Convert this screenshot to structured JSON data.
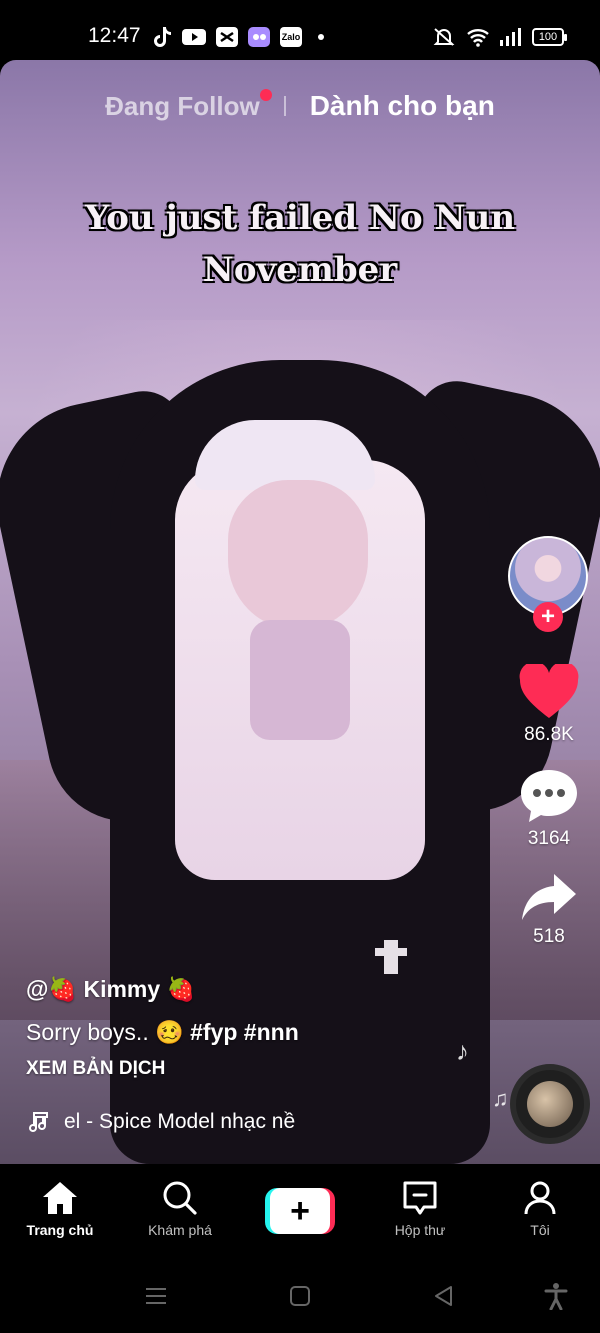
{
  "status_bar": {
    "time": "12:47",
    "apps": [
      "tiktok-icon",
      "youtube-icon",
      "capcut-icon",
      "messenger-icon",
      "zalo-icon"
    ],
    "zalo_label": "Zalo",
    "battery": "100"
  },
  "feed_tabs": {
    "following": "Đang Follow",
    "for_you": "Dành cho bạn"
  },
  "video": {
    "caption_line1": "You just failed No Nun",
    "caption_line2": "November"
  },
  "actions": {
    "likes": "86.8K",
    "comments": "3164",
    "shares": "518"
  },
  "post": {
    "username": "@🍓 Kimmy 🍓",
    "description_text": "Sorry boys.. 🥴 ",
    "hashtags": "#fyp #nnn",
    "translate_label": "XEM BẢN DỊCH",
    "music": "el - Spice Model    nhạc nề"
  },
  "nav": {
    "home": "Trang chủ",
    "discover": "Khám phá",
    "create": "+",
    "inbox": "Hộp thư",
    "profile": "Tôi"
  },
  "colors": {
    "accent_red": "#fe2c55",
    "accent_cyan": "#25f4ee",
    "like_red": "#fe2c55"
  }
}
